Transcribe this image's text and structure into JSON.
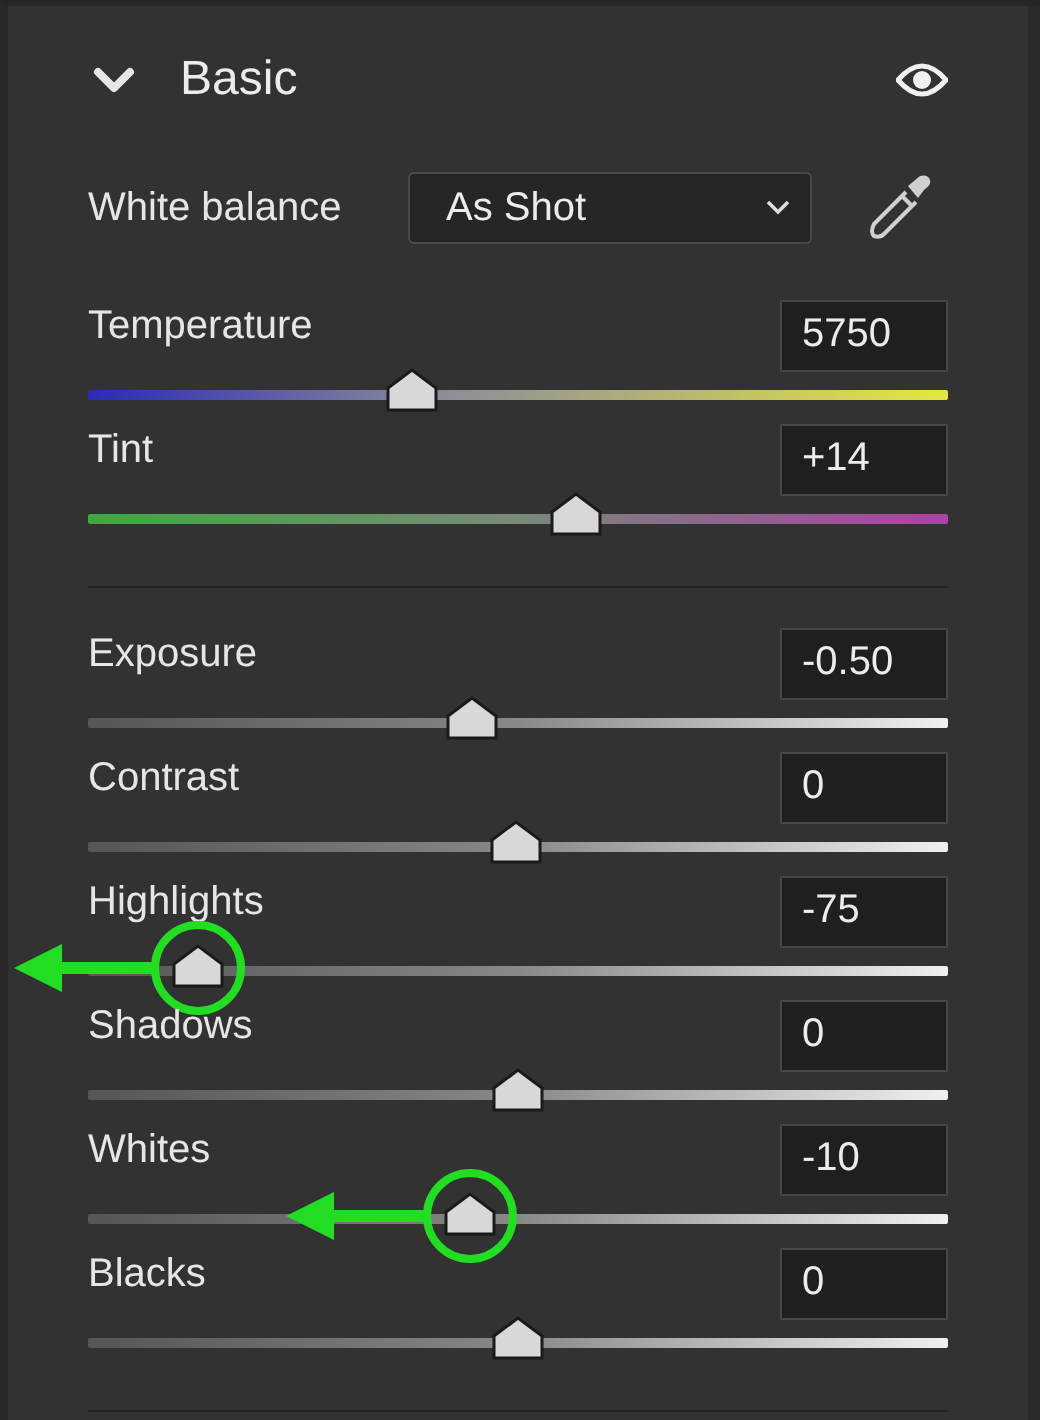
{
  "panel": {
    "title": "Basic",
    "expanded": true
  },
  "white_balance": {
    "label": "White balance",
    "value": "As Shot"
  },
  "color_sliders": [
    {
      "kind": "temperature",
      "label": "Temperature",
      "value": "5750",
      "level": 0.377
    },
    {
      "kind": "tint",
      "label": "Tint",
      "value": "+14",
      "level": 0.567
    }
  ],
  "tone_sliders": [
    {
      "kind": "tone",
      "label": "Exposure",
      "value": "-0.50",
      "level": 0.447,
      "annotated": false
    },
    {
      "kind": "tone",
      "label": "Contrast",
      "value": "0",
      "level": 0.498,
      "annotated": false
    },
    {
      "kind": "tone",
      "label": "Highlights",
      "value": "-75",
      "level": 0.128,
      "annotated": true
    },
    {
      "kind": "tone",
      "label": "Shadows",
      "value": "0",
      "level": 0.5,
      "annotated": false
    },
    {
      "kind": "tone",
      "label": "Whites",
      "value": "-10",
      "level": 0.444,
      "annotated": true
    },
    {
      "kind": "tone",
      "label": "Blacks",
      "value": "0",
      "level": 0.5,
      "annotated": false
    }
  ]
}
